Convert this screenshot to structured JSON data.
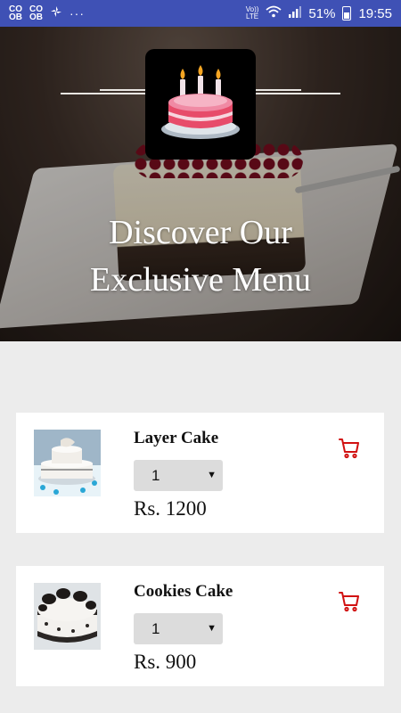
{
  "status_bar": {
    "network_label": "LTE",
    "volte_label": "Vo))",
    "battery": "51%",
    "time": "19:55",
    "left_icons": [
      "notification-icon",
      "notification-icon",
      "fan-icon"
    ],
    "more": "···"
  },
  "hero": {
    "title_line1": "Discover Our",
    "title_line2": "Exclusive Menu",
    "logo_icon": "birthday-cake-icon"
  },
  "products": [
    {
      "name": "Layer Cake",
      "quantity": "1",
      "price": "Rs. 1200",
      "image_icon": "layer-cake-photo",
      "cart_icon": "cart-icon"
    },
    {
      "name": "Cookies Cake",
      "quantity": "1",
      "price": "Rs. 900",
      "image_icon": "cookies-cake-photo",
      "cart_icon": "cart-icon"
    }
  ],
  "colors": {
    "status_bar": "#3f51b5",
    "page_bg": "#ececec",
    "cart_red": "#d11111"
  }
}
